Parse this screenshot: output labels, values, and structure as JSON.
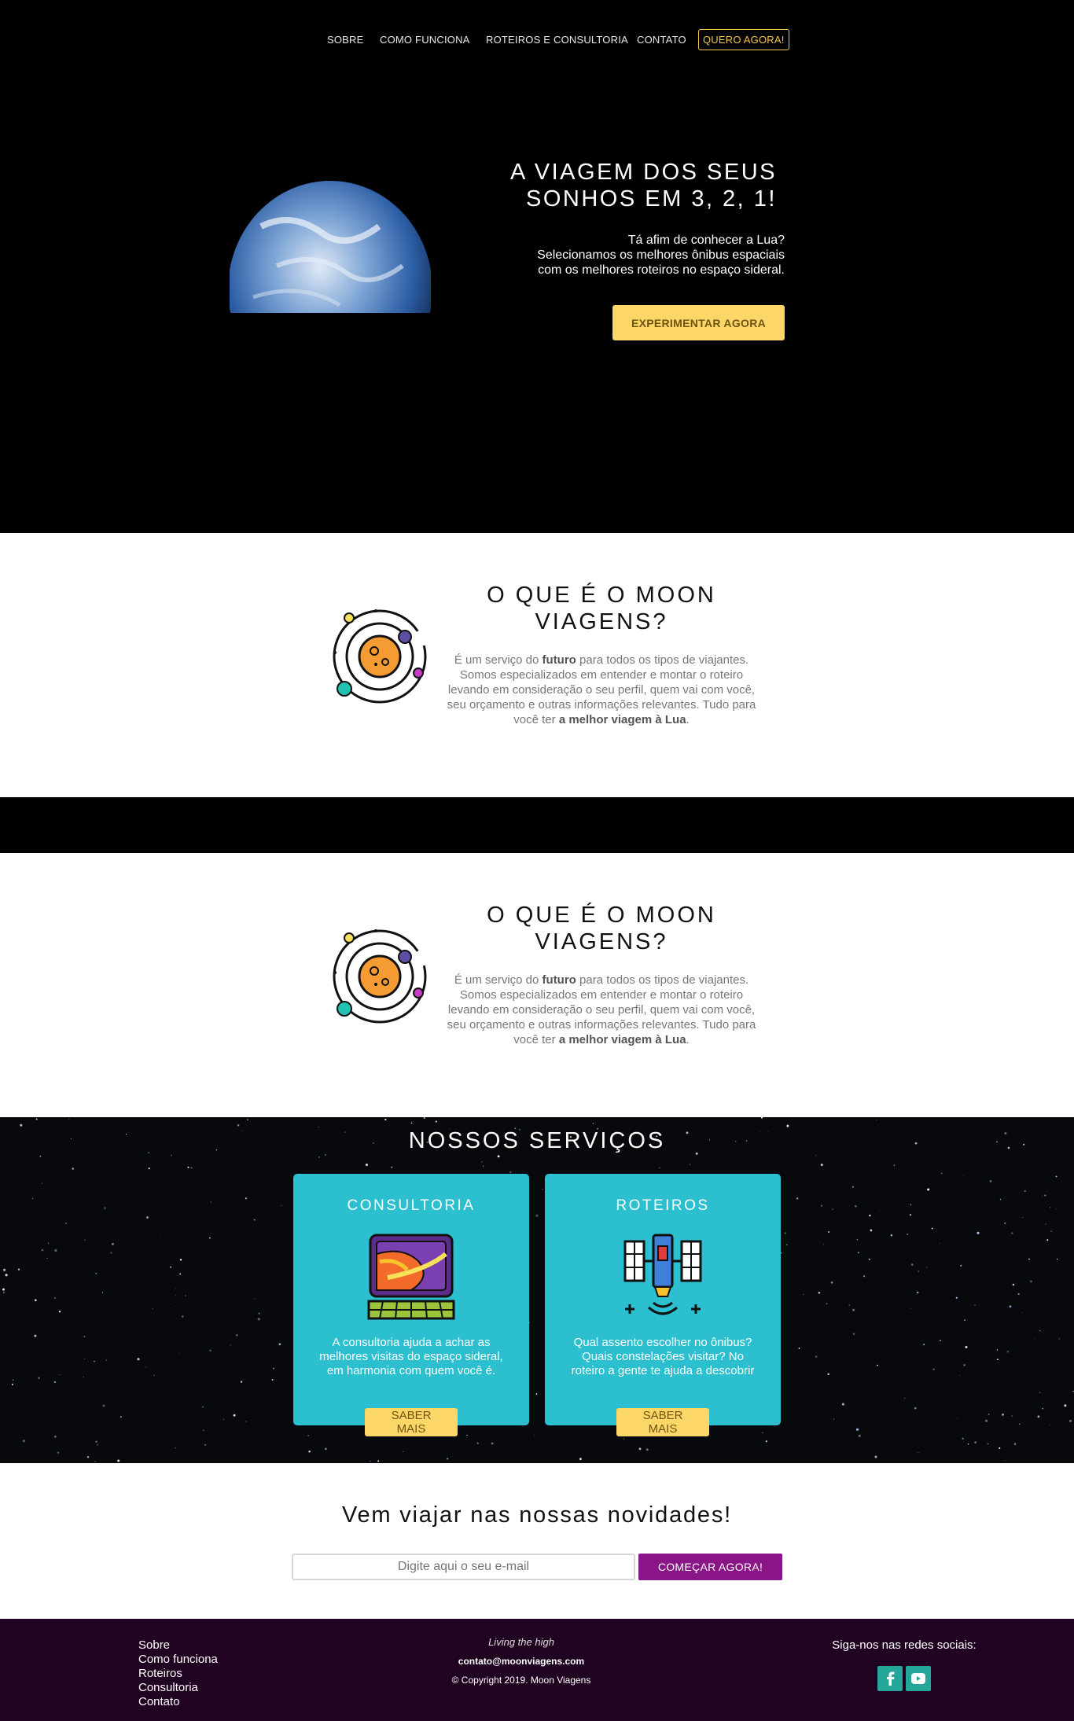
{
  "nav": {
    "items": [
      "SOBRE",
      "COMO FUNCIONA",
      "ROTEIROS E CONSULTORIA",
      "CONTATO"
    ],
    "cta": "QUERO AGORA!"
  },
  "hero": {
    "title_line1": "A VIAGEM DOS SEUS",
    "title_line2": "SONHOS EM 3, 2, 1!",
    "sub_line1": "Tá afim de conhecer a Lua?",
    "sub_line2": "Selecionamos os melhores ônibus espaciais",
    "sub_line3": "com os melhores roteiros no espaço sideral.",
    "button": "EXPERIMENTAR AGORA"
  },
  "about": {
    "title_line1": "O QUE É O MOON",
    "title_line2": "VIAGENS?",
    "text_a": "É um serviço do ",
    "text_bold1": "futuro",
    "text_b": " para todos os tipos de viajantes. Somos especializados em entender e montar o roteiro levando em consideração o seu perfil, quem vai com você, seu orçamento e outras informações relevantes. Tudo para você ter ",
    "text_bold2": "a melhor viagem à Lua",
    "text_c": "."
  },
  "services": {
    "title": "NOSSOS SERVIÇOS",
    "cards": [
      {
        "title": "CONSULTORIA",
        "text": "A consultoria ajuda a achar as melhores visitas do espaço sideral, em harmonia com quem você é.",
        "button": "SABER MAIS",
        "icon": "planet-screen-icon"
      },
      {
        "title": "ROTEIROS",
        "text": "Qual assento escolher no ônibus? Quais constelações visitar? No roteiro a gente te ajuda a descobrir",
        "button": "SABER MAIS",
        "icon": "satellite-icon"
      }
    ]
  },
  "newsletter": {
    "title": "Vem viajar nas nossas novidades!",
    "placeholder": "Digite aqui o seu e-mail",
    "button": "COMEÇAR AGORA!"
  },
  "footer": {
    "links": [
      "Sobre",
      "Como funciona",
      "Roteiros",
      "Consultoria",
      "Contato"
    ],
    "tagline": "Living the high",
    "email": "contato@moonviagens.com",
    "copyright": "© Copyright 2019. Moon Viagens",
    "social_label": "Siga-nos nas redes sociais:",
    "social_icons": [
      "facebook-icon",
      "youtube-icon"
    ]
  },
  "colors": {
    "accent_yellow": "#fcd667",
    "card_teal": "#2bbfcf",
    "news_purple": "#8a1587",
    "footer_bg": "#1f0320",
    "social_teal": "#25a69a"
  }
}
